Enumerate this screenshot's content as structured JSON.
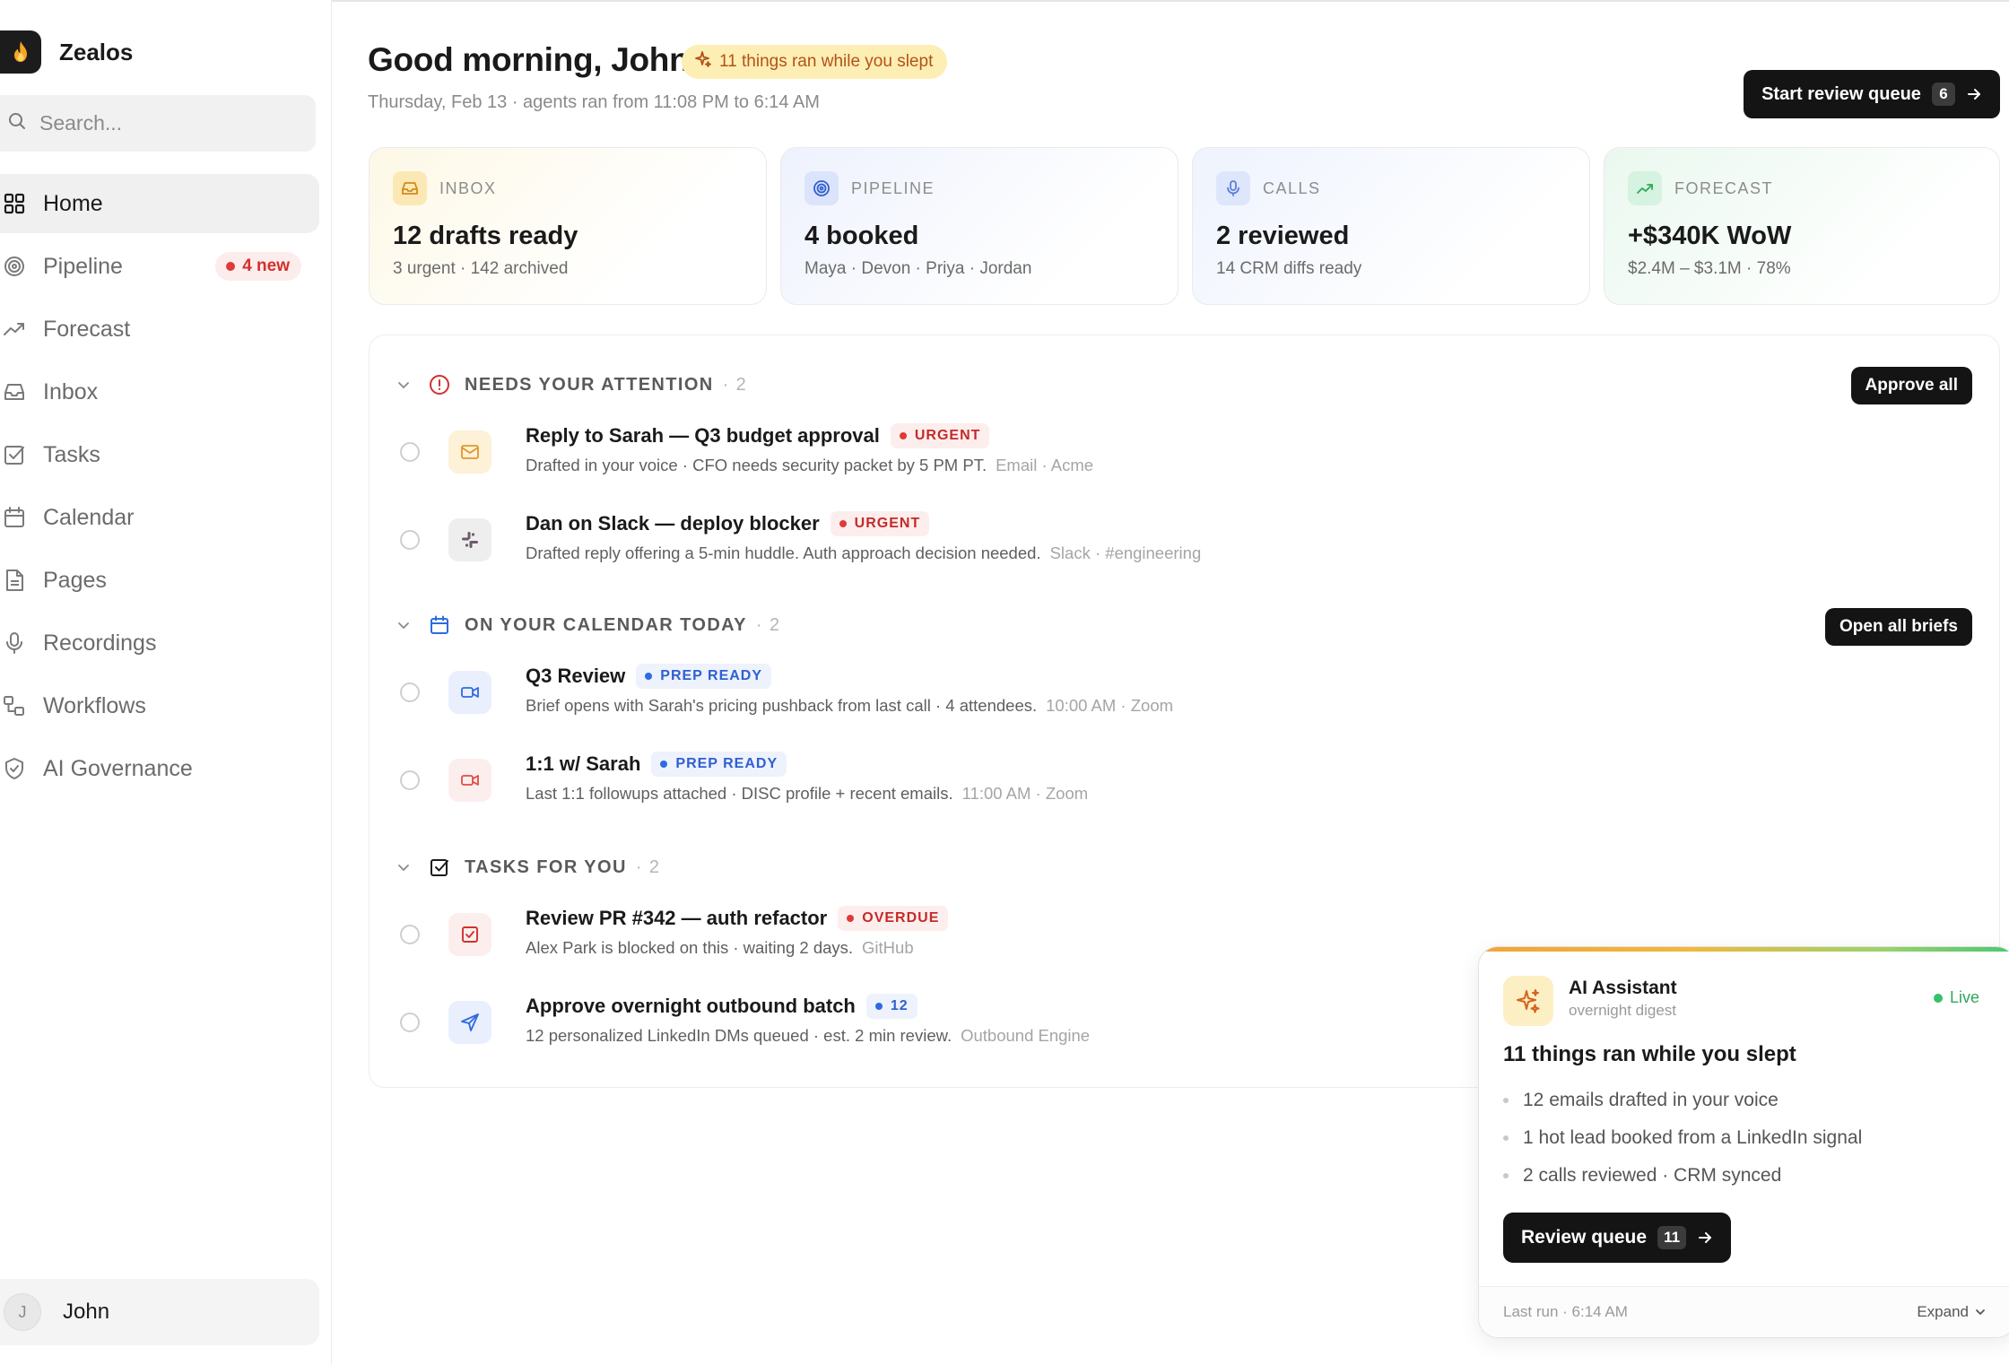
{
  "app": {
    "name": "Zealos"
  },
  "search": {
    "placeholder": "Search..."
  },
  "nav": [
    {
      "label": "Home",
      "icon": "grid-icon",
      "active": true
    },
    {
      "label": "Pipeline",
      "icon": "target-icon",
      "badge": "4 new"
    },
    {
      "label": "Forecast",
      "icon": "trend-icon"
    },
    {
      "label": "Inbox",
      "icon": "inbox-icon"
    },
    {
      "label": "Tasks",
      "icon": "checkbox-icon"
    },
    {
      "label": "Calendar",
      "icon": "calendar-icon"
    },
    {
      "label": "Pages",
      "icon": "page-icon"
    },
    {
      "label": "Recordings",
      "icon": "mic-icon"
    },
    {
      "label": "Workflows",
      "icon": "workflow-icon"
    },
    {
      "label": "AI Governance",
      "icon": "shield-icon"
    }
  ],
  "user": {
    "initial": "J",
    "name": "John"
  },
  "header": {
    "greeting": "Good morning, John",
    "pill": "11 things ran while you slept",
    "subhead": "Thursday, Feb 13 · agents ran from 11:08 PM to 6:14 AM",
    "start_button": "Start review queue",
    "start_count": "6"
  },
  "cards": [
    {
      "caption": "INBOX",
      "value": "12 drafts ready",
      "sub": "3 urgent · 142 archived"
    },
    {
      "caption": "PIPELINE",
      "value": "4 booked",
      "sub": "Maya · Devon · Priya · Jordan"
    },
    {
      "caption": "CALLS",
      "value": "2 reviewed",
      "sub": "14 CRM diffs ready"
    },
    {
      "caption": "FORECAST",
      "value": "+$340K WoW",
      "sub": "$2.4M – $3.1M · 78%"
    }
  ],
  "sections": [
    {
      "title": "NEEDS YOUR ATTENTION",
      "count": "· 2",
      "button": "Approve all",
      "rows": [
        {
          "title": "Reply to Sarah — Q3 budget approval",
          "tag": "URGENT",
          "desc": "Drafted in your voice · CFO needs security packet by 5 PM PT.",
          "src": "Email · Acme"
        },
        {
          "title": "Dan on Slack — deploy blocker",
          "tag": "URGENT",
          "desc": "Drafted reply offering a 5-min huddle. Auth approach decision needed.",
          "src": "Slack · #engineering"
        }
      ]
    },
    {
      "title": "ON YOUR CALENDAR TODAY",
      "count": "· 2",
      "button": "Open all briefs",
      "rows": [
        {
          "title": "Q3 Review",
          "tag": "PREP READY",
          "desc": "Brief opens with Sarah's pricing pushback from last call · 4 attendees.",
          "src": "10:00 AM · Zoom"
        },
        {
          "title": "1:1 w/ Sarah",
          "tag": "PREP READY",
          "desc": "Last 1:1 followups attached · DISC profile + recent emails.",
          "src": "11:00 AM · Zoom"
        }
      ]
    },
    {
      "title": "TASKS FOR YOU",
      "count": "· 2",
      "rows": [
        {
          "title": "Review PR #342 — auth refactor",
          "tag": "OVERDUE",
          "desc": "Alex Park is blocked on this · waiting 2 days.",
          "src": "GitHub"
        },
        {
          "title": "Approve overnight outbound batch",
          "tag": "12",
          "desc": "12 personalized LinkedIn DMs queued · est. 2 min review.",
          "src": "Outbound Engine"
        }
      ]
    }
  ],
  "assistant": {
    "name": "AI Assistant",
    "subtitle": "overnight digest",
    "status": "Live",
    "title": "11 things ran while you slept",
    "items": [
      "12 emails drafted in your voice",
      "1 hot lead booked from a LinkedIn signal",
      "2 calls reviewed · CRM synced"
    ],
    "button": "Review queue",
    "button_count": "11",
    "last_run": "Last run · 6:14 AM",
    "expand": "Expand"
  },
  "colors": {
    "accent_dark": "#141414",
    "urgent": "#c42b27",
    "prep": "#2f5fd1",
    "live": "#2fa85a",
    "pill_bg": "#fdeeb3"
  }
}
